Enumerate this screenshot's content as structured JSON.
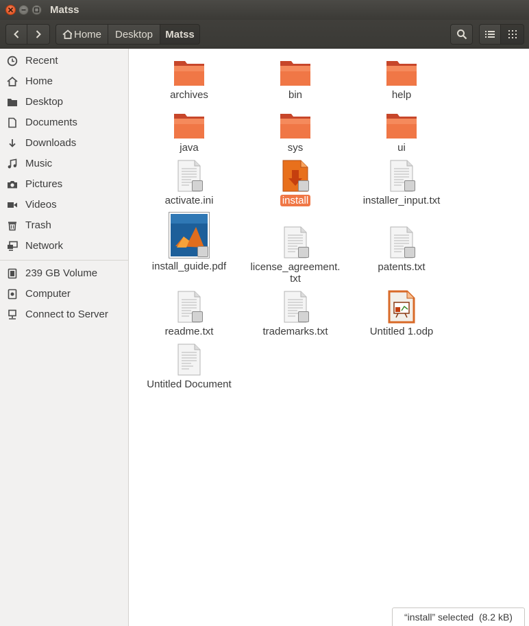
{
  "window": {
    "title": "Matss"
  },
  "toolbar": {
    "breadcrumbs": [
      "Home",
      "Desktop",
      "Matss"
    ],
    "icons": {
      "back": "chevron-left-icon",
      "forward": "chevron-right-icon",
      "home": "home-icon",
      "search": "search-icon",
      "list_view": "list-view-icon",
      "grid_view": "grid-view-icon"
    }
  },
  "sidebar": {
    "items": [
      {
        "label": "Recent",
        "icon": "clock-icon"
      },
      {
        "label": "Home",
        "icon": "home-icon"
      },
      {
        "label": "Desktop",
        "icon": "folder-icon"
      },
      {
        "label": "Documents",
        "icon": "document-icon"
      },
      {
        "label": "Downloads",
        "icon": "download-icon"
      },
      {
        "label": "Music",
        "icon": "music-icon"
      },
      {
        "label": "Pictures",
        "icon": "camera-icon"
      },
      {
        "label": "Videos",
        "icon": "video-icon"
      },
      {
        "label": "Trash",
        "icon": "trash-icon"
      },
      {
        "label": "Network",
        "icon": "network-icon"
      }
    ],
    "devices": [
      {
        "label": "239 GB Volume",
        "icon": "drive-icon"
      },
      {
        "label": "Computer",
        "icon": "computer-icon"
      },
      {
        "label": "Connect to Server",
        "icon": "server-icon"
      }
    ]
  },
  "files": [
    {
      "name": "archives",
      "type": "folder"
    },
    {
      "name": "bin",
      "type": "folder"
    },
    {
      "name": "help",
      "type": "folder"
    },
    {
      "name": "java",
      "type": "folder"
    },
    {
      "name": "sys",
      "type": "folder"
    },
    {
      "name": "ui",
      "type": "folder"
    },
    {
      "name": "activate.ini",
      "type": "text"
    },
    {
      "name": "install",
      "type": "installer",
      "selected": true
    },
    {
      "name": "installer_input.txt",
      "type": "text"
    },
    {
      "name": "install_guide.pdf",
      "type": "pdf"
    },
    {
      "name": "license_agreement.\ntxt",
      "type": "text"
    },
    {
      "name": "patents.txt",
      "type": "text"
    },
    {
      "name": "readme.txt",
      "type": "text"
    },
    {
      "name": "trademarks.txt",
      "type": "text"
    },
    {
      "name": "Untitled 1.odp",
      "type": "presentation"
    },
    {
      "name": "Untitled Document",
      "type": "text"
    }
  ],
  "status": {
    "text": "“install” selected  (8.2 kB)"
  },
  "colors": {
    "accent": "#f07746",
    "folder": "#e95420",
    "titlebar": "#3c3b37"
  }
}
